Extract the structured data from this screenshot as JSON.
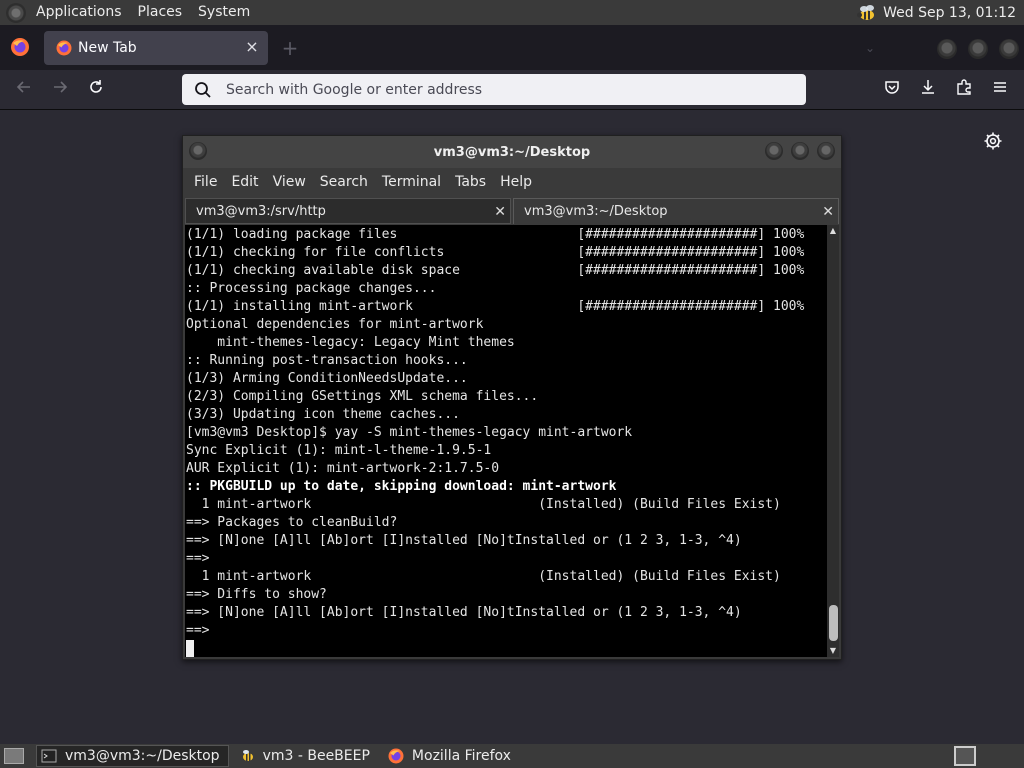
{
  "top_panel": {
    "menus": [
      "Applications",
      "Places",
      "System"
    ],
    "clock": "Wed Sep 13, 01:12"
  },
  "firefox": {
    "tab": {
      "title": "New Tab"
    },
    "urlbar": {
      "placeholder": "Search with Google or enter address",
      "value": ""
    }
  },
  "terminal": {
    "title": "vm3@vm3:~/Desktop",
    "menu": [
      "File",
      "Edit",
      "View",
      "Search",
      "Terminal",
      "Tabs",
      "Help"
    ],
    "tabs": [
      {
        "label": "vm3@vm3:/srv/http",
        "active": false
      },
      {
        "label": "vm3@vm3:~/Desktop",
        "active": true
      }
    ],
    "lines": [
      {
        "text": "(1/1) loading package files                       [######################] 100%",
        "bold": false
      },
      {
        "text": "(1/1) checking for file conflicts                 [######################] 100%",
        "bold": false
      },
      {
        "text": "(1/1) checking available disk space               [######################] 100%",
        "bold": false
      },
      {
        "text": ":: Processing package changes...",
        "bold": false
      },
      {
        "text": "(1/1) installing mint-artwork                     [######################] 100%",
        "bold": false
      },
      {
        "text": "Optional dependencies for mint-artwork",
        "bold": false
      },
      {
        "text": "    mint-themes-legacy: Legacy Mint themes",
        "bold": false
      },
      {
        "text": ":: Running post-transaction hooks...",
        "bold": false
      },
      {
        "text": "(1/3) Arming ConditionNeedsUpdate...",
        "bold": false
      },
      {
        "text": "(2/3) Compiling GSettings XML schema files...",
        "bold": false
      },
      {
        "text": "(3/3) Updating icon theme caches...",
        "bold": false
      },
      {
        "text": "[vm3@vm3 Desktop]$ yay -S mint-themes-legacy mint-artwork",
        "bold": false
      },
      {
        "text": "Sync Explicit (1): mint-l-theme-1.9.5-1",
        "bold": false
      },
      {
        "text": "AUR Explicit (1): mint-artwork-2:1.7.5-0",
        "bold": false
      },
      {
        "text": ":: PKGBUILD up to date, skipping download: mint-artwork",
        "bold": true
      },
      {
        "text": "  1 mint-artwork                             (Installed) (Build Files Exist)",
        "bold": false
      },
      {
        "text": "==> Packages to cleanBuild?",
        "bold": false
      },
      {
        "text": "==> [N]one [A]ll [Ab]ort [I]nstalled [No]tInstalled or (1 2 3, 1-3, ^4)",
        "bold": false
      },
      {
        "text": "==>",
        "bold": false
      },
      {
        "text": "  1 mint-artwork                             (Installed) (Build Files Exist)",
        "bold": false
      },
      {
        "text": "==> Diffs to show?",
        "bold": false
      },
      {
        "text": "==> [N]one [A]ll [Ab]ort [I]nstalled [No]tInstalled or (1 2 3, 1-3, ^4)",
        "bold": false
      },
      {
        "text": "==>",
        "bold": false
      }
    ]
  },
  "taskbar": {
    "tasks": [
      {
        "label": "vm3@vm3:~/Desktop",
        "icon": "terminal-icon",
        "active": true
      },
      {
        "label": "vm3 - BeeBEEP",
        "icon": "beebeep-icon",
        "active": false
      },
      {
        "label": "Mozilla Firefox",
        "icon": "firefox-icon",
        "active": false
      }
    ]
  }
}
